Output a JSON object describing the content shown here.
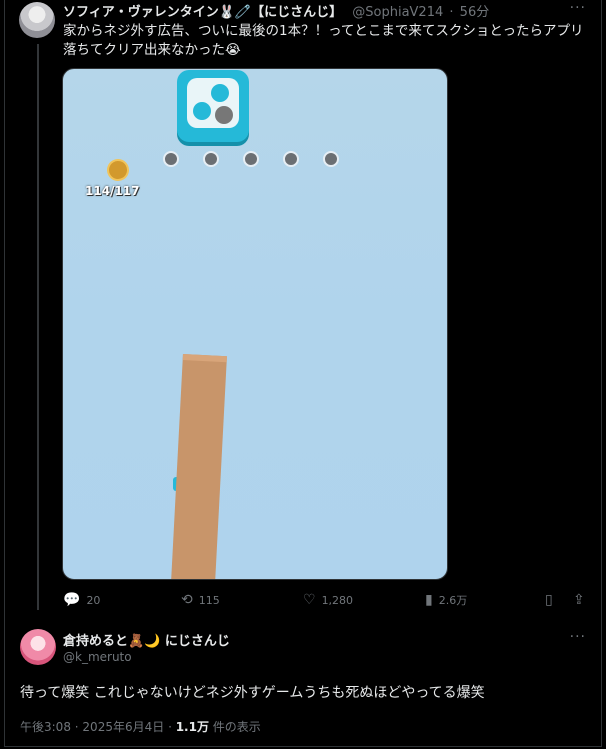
{
  "tweet1": {
    "display_name": "ソフィア・ヴァレンタイン🐰🧷【にじさんじ】",
    "handle": "@SophiaV214",
    "time": "56分",
    "separator": "·",
    "more": "···",
    "text": "家からネジ外す広告、ついに最後の1本？！ってとこまで来てスクショとったらアプリ落ちてクリア出来なかった😭",
    "media": {
      "counter": "114/117",
      "holes_count": 5
    },
    "actions": {
      "replies": "20",
      "retweets": "115",
      "likes": "1,280",
      "views": "2.6万"
    }
  },
  "tweet2": {
    "display_name": "倉持めると🧸🌙 にじさんじ",
    "handle": "@k_meruto",
    "more": "···",
    "text": "待って爆笑 これじゃないけどネジ外すゲームうちも死ぬほどやってる爆笑",
    "time": "午後3:08",
    "date": "2025年6月4日",
    "views_count": "1.1万",
    "views_label": "件の表示"
  }
}
